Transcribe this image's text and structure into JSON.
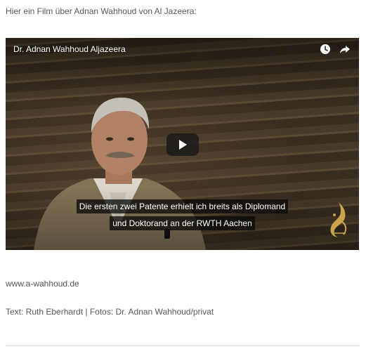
{
  "intro_text": "Hier ein Film über Adnan Wahhoud von Al Jazeera:",
  "video": {
    "title": "Dr. Adnan Wahhoud Aljazeera",
    "icons": [
      "clock-icon",
      "share-icon",
      "play-icon",
      "aljazeera-logo"
    ],
    "subtitle_lines": [
      "Die ersten zwei Patente erhielt ich breits als Diplomand",
      "und Doktorand an der RWTH Aachen"
    ]
  },
  "link_text": "www.a-wahhoud.de",
  "credits_text": "Text: Ruth Eberhardt | Fotos: Dr. Adnan Wahhoud/privat",
  "colors": {
    "text": "#555555",
    "video_overlay": "#191919",
    "logo_gold": "#c9a44a"
  }
}
